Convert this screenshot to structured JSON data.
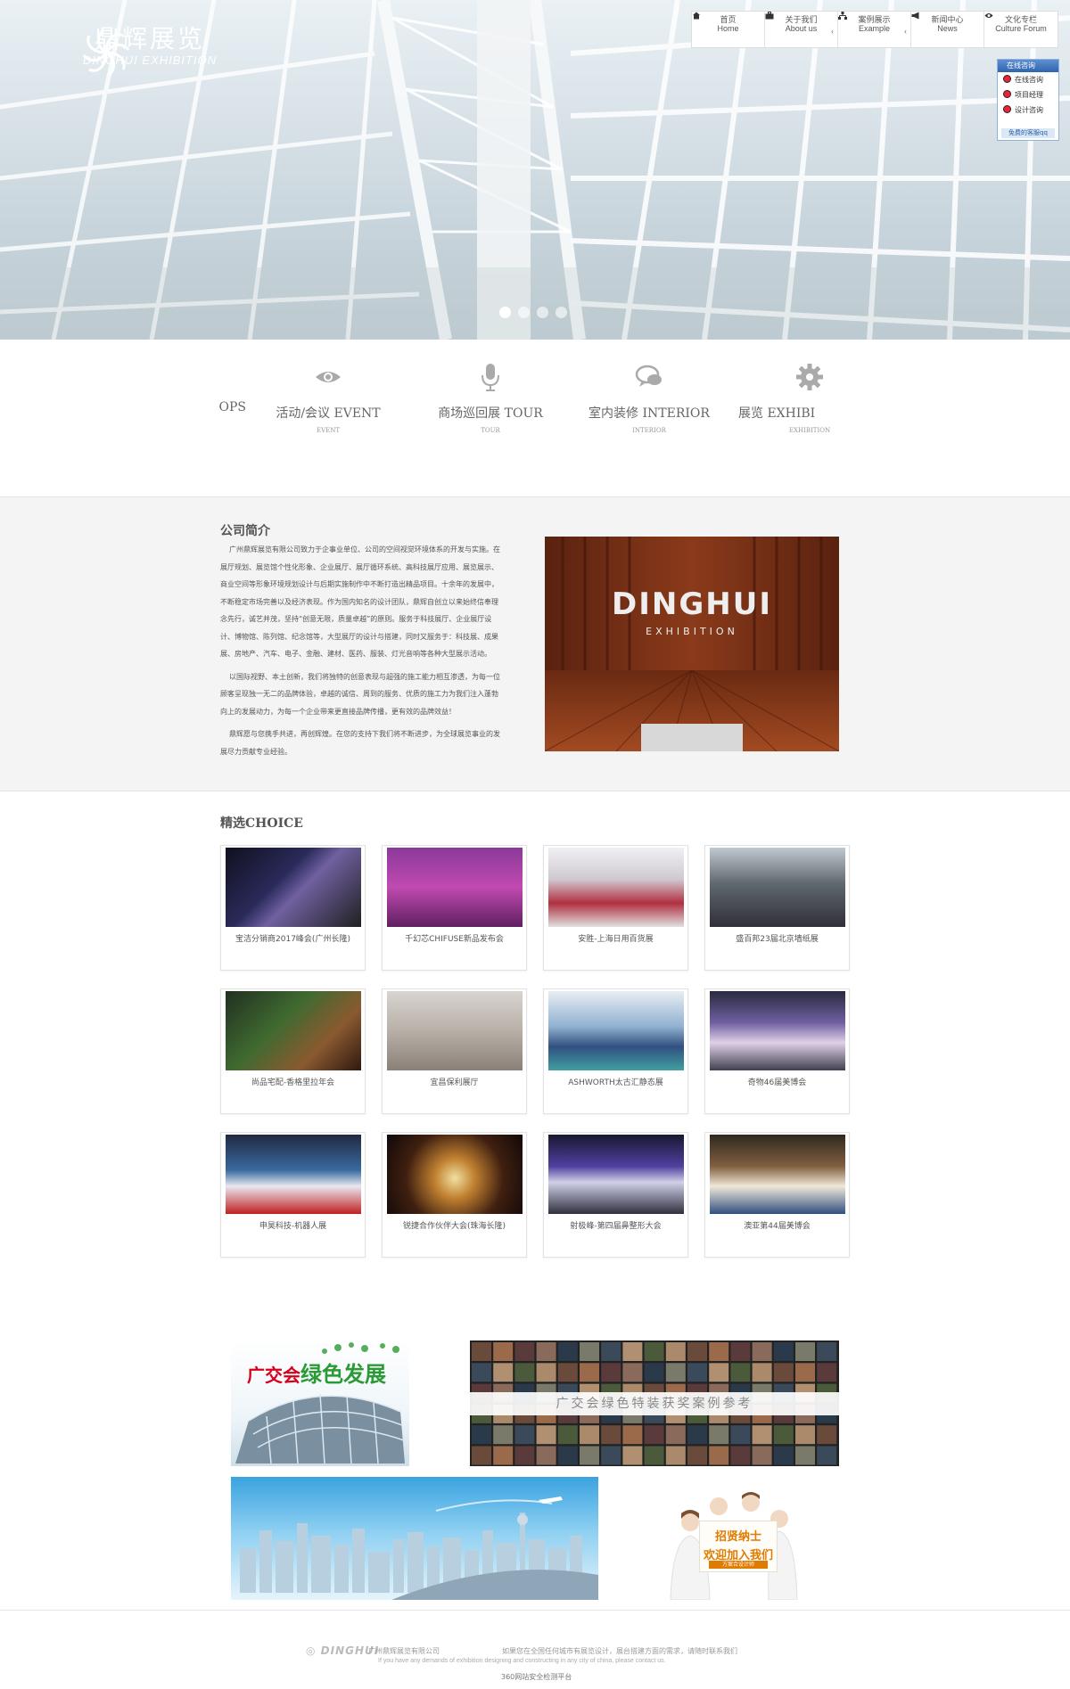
{
  "brand": {
    "cn": "鼎辉展览",
    "en": "DINGHUI EXHIBITION"
  },
  "nav": [
    {
      "cn": "首页",
      "en": "Home",
      "icon": "home-icon"
    },
    {
      "cn": "关于我们",
      "en": "About us",
      "icon": "briefcase-icon"
    },
    {
      "cn": "案例展示",
      "en": "Example",
      "icon": "sitemap-icon"
    },
    {
      "cn": "新闻中心",
      "en": "News",
      "icon": "bullhorn-icon"
    },
    {
      "cn": "文化专栏",
      "en": "Culture Forum",
      "icon": "eye-icon"
    }
  ],
  "online": {
    "title": "在线咨询",
    "items": [
      "在线咨询",
      "项目经理",
      "设计咨询"
    ],
    "footer": "免费的客服qq"
  },
  "slider": {
    "count": 4,
    "active": 0
  },
  "services": [
    {
      "title": "OPS",
      "sub": "",
      "icon": "partial-icon"
    },
    {
      "title": "活动/会议 EVENT",
      "sub": "EVENT",
      "icon": "eye-icon"
    },
    {
      "title": "商场巡回展 TOUR",
      "sub": "TOUR",
      "icon": "microphone-icon"
    },
    {
      "title": "室内装修 INTERIOR",
      "sub": "INTERIOR",
      "icon": "chat-icon"
    },
    {
      "title": "展览 EXHIBI",
      "sub": "EXHIBITION",
      "icon": "gear-icon"
    }
  ],
  "about": {
    "title": "公司简介",
    "paragraphs": [
      "广州鼎辉展览有限公司致力于企事业单位、公司的空间视觉环境体系的开发与实施。在展厅规划、展览馆个性化形象、企业展厅、展厅循环系统、高科技展厅应用、展览展示、商业空间等形象环境规划设计与后期实施制作中不断打造出精品项目。十余年的发展中，不断稳定市场完善以及经济表现。作为国内知名的设计团队，鼎辉自创立以来始终信奉理念先行，诚艺并茂，坚持“创意无限，质量卓越”的原则。服务于科技展厅、企业展厅设计、博物馆、陈列馆、纪念馆等，大型展厅的设计与搭建，同时又服务于：科技展、成果展、房地产、汽车、电子、金融、建材、医药、服装、灯光音响等各种大型展示活动。",
      "以国际视野、本土创新，我们将独特的创意表现与超强的施工能力相互渗透，为每一位顾客呈现独一无二的品牌体验，卓越的诚信、周到的服务、优质的施工力为我们注入蓬勃向上的发展动力，为每一个企业带来更直接品牌传播，更有效的品牌效益！",
      "鼎辉愿与您携手共进，再创辉煌。在您的支持下我们将不断进步，为全球展览事业的发展尽力贡献专业经验。"
    ],
    "image_text": {
      "main": "DINGHUI",
      "sub": "EXHIBITION"
    }
  },
  "choice": {
    "title": "精选CHOICE",
    "items": [
      "宝洁分销商2017峰会(广州长隆)",
      "千幻芯CHIFUSE新品发布会",
      "安胜-上海日用百货展",
      "盛百邦23届北京墙纸展",
      "尚品宅配-香格里拉年会",
      "宜昌保利展厅",
      "ASHWORTH太古汇静态展",
      "奇物46届美博会",
      "申昊科技-机器人展",
      "锐捷合作伙伴大会(珠海长隆)",
      "射极峰-第四届鼻整形大会",
      "澳亚第44届美博会"
    ]
  },
  "banners": {
    "green_pre": "广交会",
    "green_hl": "绿色发展",
    "cases": "广交会绿色特装获奖案例参考",
    "join1": "招贤纳士",
    "join2": "欢迎加入我们",
    "join3": "方案合设计师"
  },
  "footer": {
    "brand": "DINGHUI",
    "company": "广州鼎辉展览有限公司",
    "message": "如果您在全国任何城市有展览设计，展台搭建方面的需求，请随时联系我们",
    "en": "If you have any demands of exhibition designing and constructing in any city of china, please contact us.",
    "safety": "360网站安全检测平台"
  },
  "colors": {
    "accent_orange": "#e07a00",
    "red": "#d6001c",
    "green": "#2a9b34"
  }
}
